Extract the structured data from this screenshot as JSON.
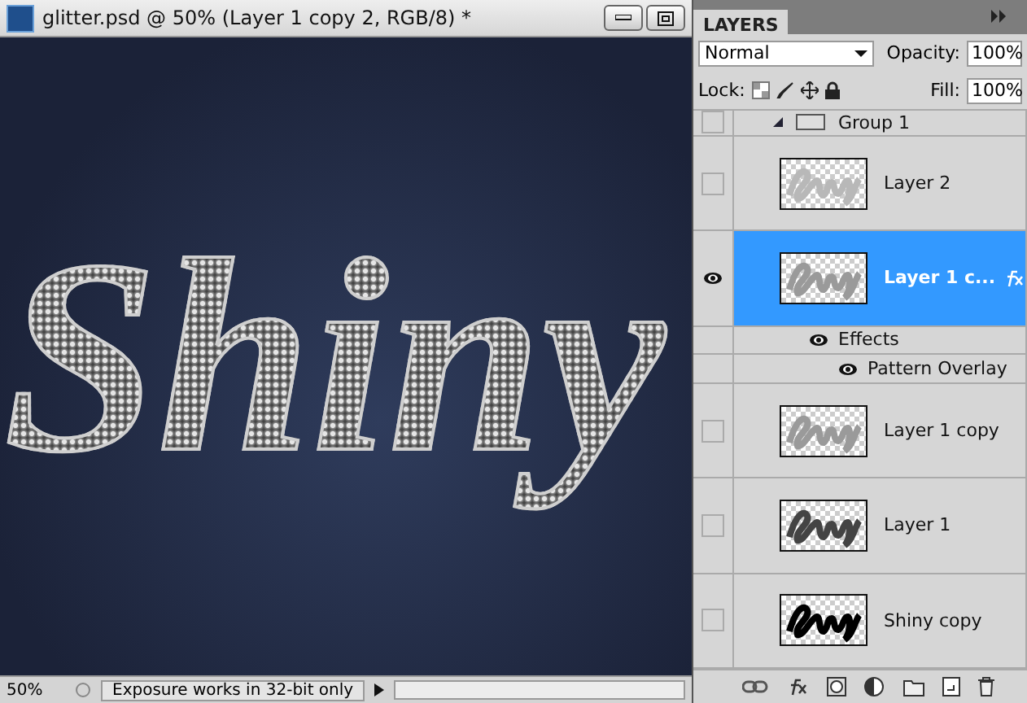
{
  "document": {
    "title": "glitter.psd @ 50% (Layer 1 copy 2, RGB/8) *",
    "canvas_text": "Shiny",
    "status": {
      "zoom": "50%",
      "message": "Exposure works in 32-bit only"
    }
  },
  "layers_panel": {
    "tab": "LAYERS",
    "blend_mode": "Normal",
    "opacity_label": "Opacity:",
    "opacity": "100%",
    "lock_label": "Lock:",
    "fill_label": "Fill:",
    "fill": "100%",
    "layers": [
      {
        "kind": "group",
        "name": "Group 1",
        "visible": false,
        "selected": false
      },
      {
        "kind": "layer",
        "name": "Layer 2",
        "visible": false,
        "selected": false,
        "fx": false,
        "thumbnail": {
          "color": "#b8b8b8"
        }
      },
      {
        "kind": "layer",
        "name": "Layer 1 c...",
        "visible": true,
        "selected": true,
        "fx": true,
        "thumbnail": {
          "color": "#9a9a9a"
        },
        "effects": {
          "label": "Effects",
          "visible": true,
          "items": [
            {
              "name": "Pattern Overlay",
              "visible": true
            }
          ]
        }
      },
      {
        "kind": "layer",
        "name": "Layer 1 copy",
        "visible": false,
        "selected": false,
        "fx": false,
        "thumbnail": {
          "color": "#9a9a9a"
        }
      },
      {
        "kind": "layer",
        "name": "Layer 1",
        "visible": false,
        "selected": false,
        "fx": false,
        "thumbnail": {
          "color": "#444444"
        }
      },
      {
        "kind": "layer",
        "name": "Shiny copy",
        "visible": false,
        "selected": false,
        "fx": false,
        "thumbnail": {
          "color": "#000000"
        }
      }
    ]
  }
}
